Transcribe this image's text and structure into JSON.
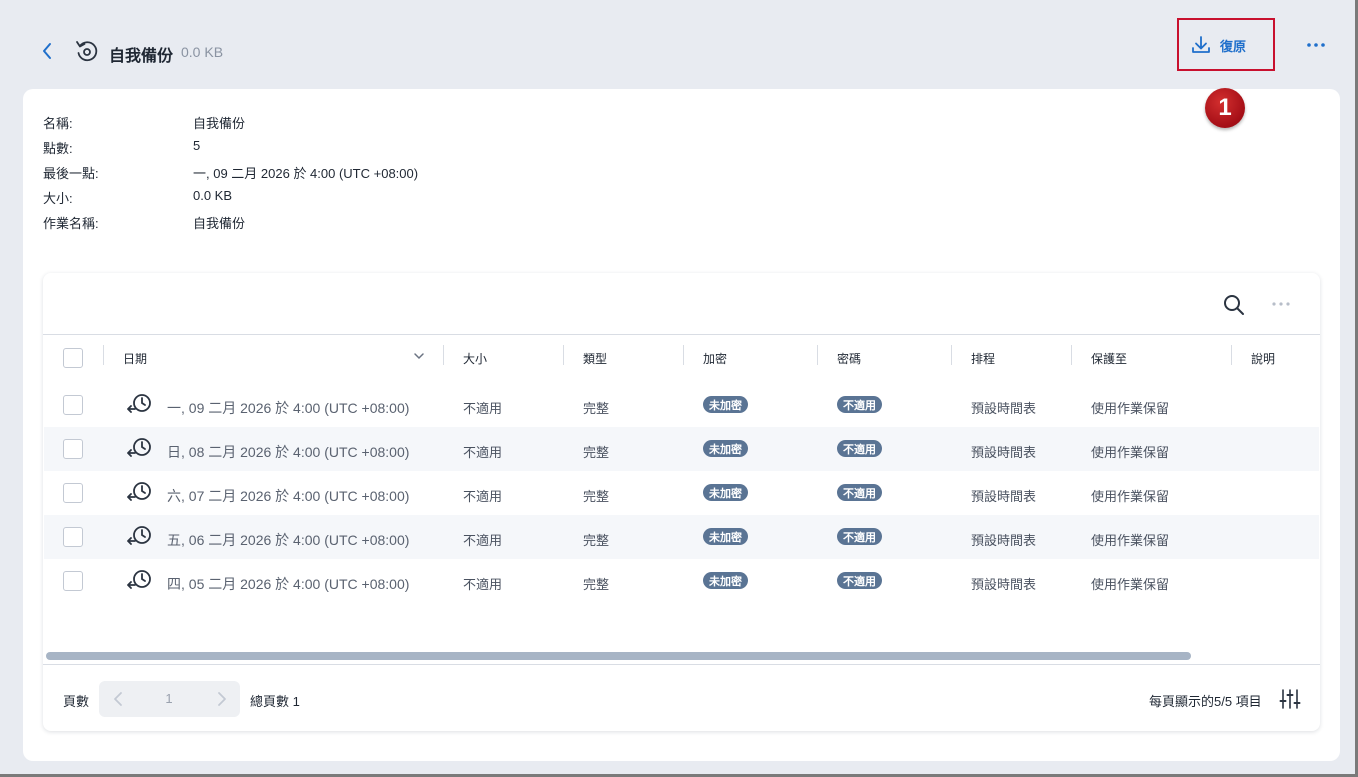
{
  "header": {
    "title": "自我備份",
    "size": "0.0 KB",
    "restore_label": "復原"
  },
  "callout": "1",
  "info": [
    {
      "label": "名稱:",
      "value": "自我備份"
    },
    {
      "label": "點數:",
      "value": "5"
    },
    {
      "label": "最後一點:",
      "value": "一, 09 二月 2026 於 4:00 (UTC +08:00)"
    },
    {
      "label": "大小:",
      "value": "0.0 KB"
    },
    {
      "label": "作業名稱:",
      "value": "自我備份"
    }
  ],
  "table": {
    "columns": [
      "日期",
      "大小",
      "類型",
      "加密",
      "密碼",
      "排程",
      "保護至",
      "說明"
    ],
    "rows": [
      {
        "date": "一, 09 二月 2026 於 4:00 (UTC +08:00)",
        "size": "不適用",
        "type": "完整",
        "encryption": "未加密",
        "password": "不適用",
        "schedule": "預設時間表",
        "protect_until": "使用作業保留"
      },
      {
        "date": "日, 08 二月 2026 於 4:00 (UTC +08:00)",
        "size": "不適用",
        "type": "完整",
        "encryption": "未加密",
        "password": "不適用",
        "schedule": "預設時間表",
        "protect_until": "使用作業保留"
      },
      {
        "date": "六, 07 二月 2026 於 4:00 (UTC +08:00)",
        "size": "不適用",
        "type": "完整",
        "encryption": "未加密",
        "password": "不適用",
        "schedule": "預設時間表",
        "protect_until": "使用作業保留"
      },
      {
        "date": "五, 06 二月 2026 於 4:00 (UTC +08:00)",
        "size": "不適用",
        "type": "完整",
        "encryption": "未加密",
        "password": "不適用",
        "schedule": "預設時間表",
        "protect_until": "使用作業保留"
      },
      {
        "date": "四, 05 二月 2026 於 4:00 (UTC +08:00)",
        "size": "不適用",
        "type": "完整",
        "encryption": "未加密",
        "password": "不適用",
        "schedule": "預設時間表",
        "protect_until": "使用作業保留"
      }
    ]
  },
  "pager": {
    "label": "頁數",
    "current_page": "1",
    "total_pages": "總頁數 1",
    "per_page": "每頁顯示的5/5 項目"
  },
  "colors": {
    "accent": "#1f6fcb",
    "badge": "#5a7494",
    "highlight": "#c8102e",
    "callout": "#a40e16"
  },
  "icons": {
    "back": "chevron-left-icon",
    "title": "backup-restore-icon",
    "restore": "download-icon",
    "more": "more-horizontal-icon",
    "search": "search-icon",
    "row": "restore-point-icon",
    "settings": "column-settings-icon"
  }
}
